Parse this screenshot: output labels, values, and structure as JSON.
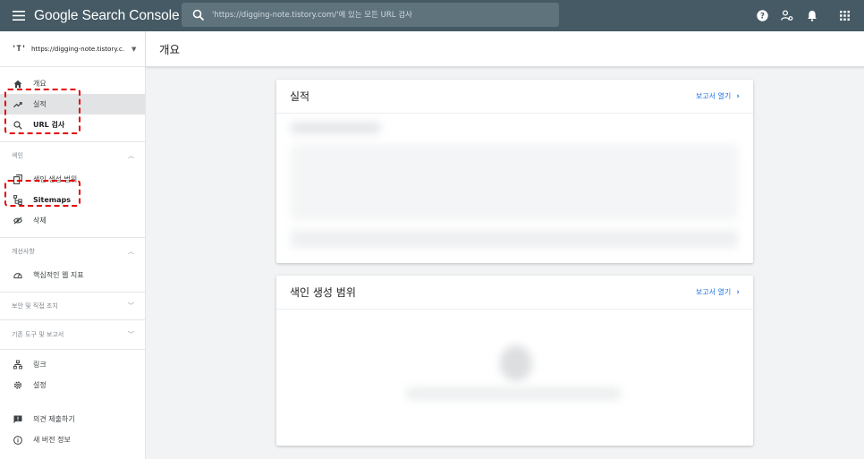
{
  "topbar": {
    "brand": "Google Search Console",
    "search_placeholder": "'https://digging-note.tistory.com/'에 있는 모든 URL 검사",
    "icons": [
      "menu-icon",
      "search-icon",
      "help-icon",
      "manage-users-icon",
      "notifications-icon",
      "apps-icon"
    ]
  },
  "sidebar": {
    "property": {
      "favicon": "'T'",
      "url": "https://digging-note.tistory.c..."
    },
    "nav": [
      {
        "label": "개요",
        "icon": "home-icon"
      },
      {
        "label": "실적",
        "icon": "trending-icon"
      },
      {
        "label": "URL 검사",
        "icon": "search-icon"
      }
    ],
    "index_section": {
      "label": "색인"
    },
    "index_items": [
      {
        "label": "색인 생성 범위",
        "icon": "coverage-icon"
      },
      {
        "label": "Sitemaps",
        "icon": "sitemap-icon"
      },
      {
        "label": "삭제",
        "icon": "removals-icon"
      }
    ],
    "enhance_section": {
      "label": "개선사항"
    },
    "enhance_items": [
      {
        "label": "핵심적인 웹 지표",
        "icon": "speed-icon"
      }
    ],
    "security_section": {
      "label": "보안 및 직접 조치"
    },
    "legacy_section": {
      "label": "기존 도구 및 보고서"
    },
    "misc_items": [
      {
        "label": "링크",
        "icon": "links-icon"
      },
      {
        "label": "설정",
        "icon": "settings-icon"
      }
    ],
    "bottom_items": [
      {
        "label": "의견 제출하기",
        "icon": "feedback-icon"
      },
      {
        "label": "새 버전 정보",
        "icon": "info-icon"
      }
    ]
  },
  "main": {
    "page_title": "개요",
    "cards": [
      {
        "title": "실적",
        "link": "보고서 열기"
      },
      {
        "title": "색인 생성 범위",
        "link": "보고서 열기"
      }
    ]
  },
  "colors": {
    "topbar": "#455a64",
    "accent": "#1a73e8",
    "annotation": "#e00000"
  }
}
